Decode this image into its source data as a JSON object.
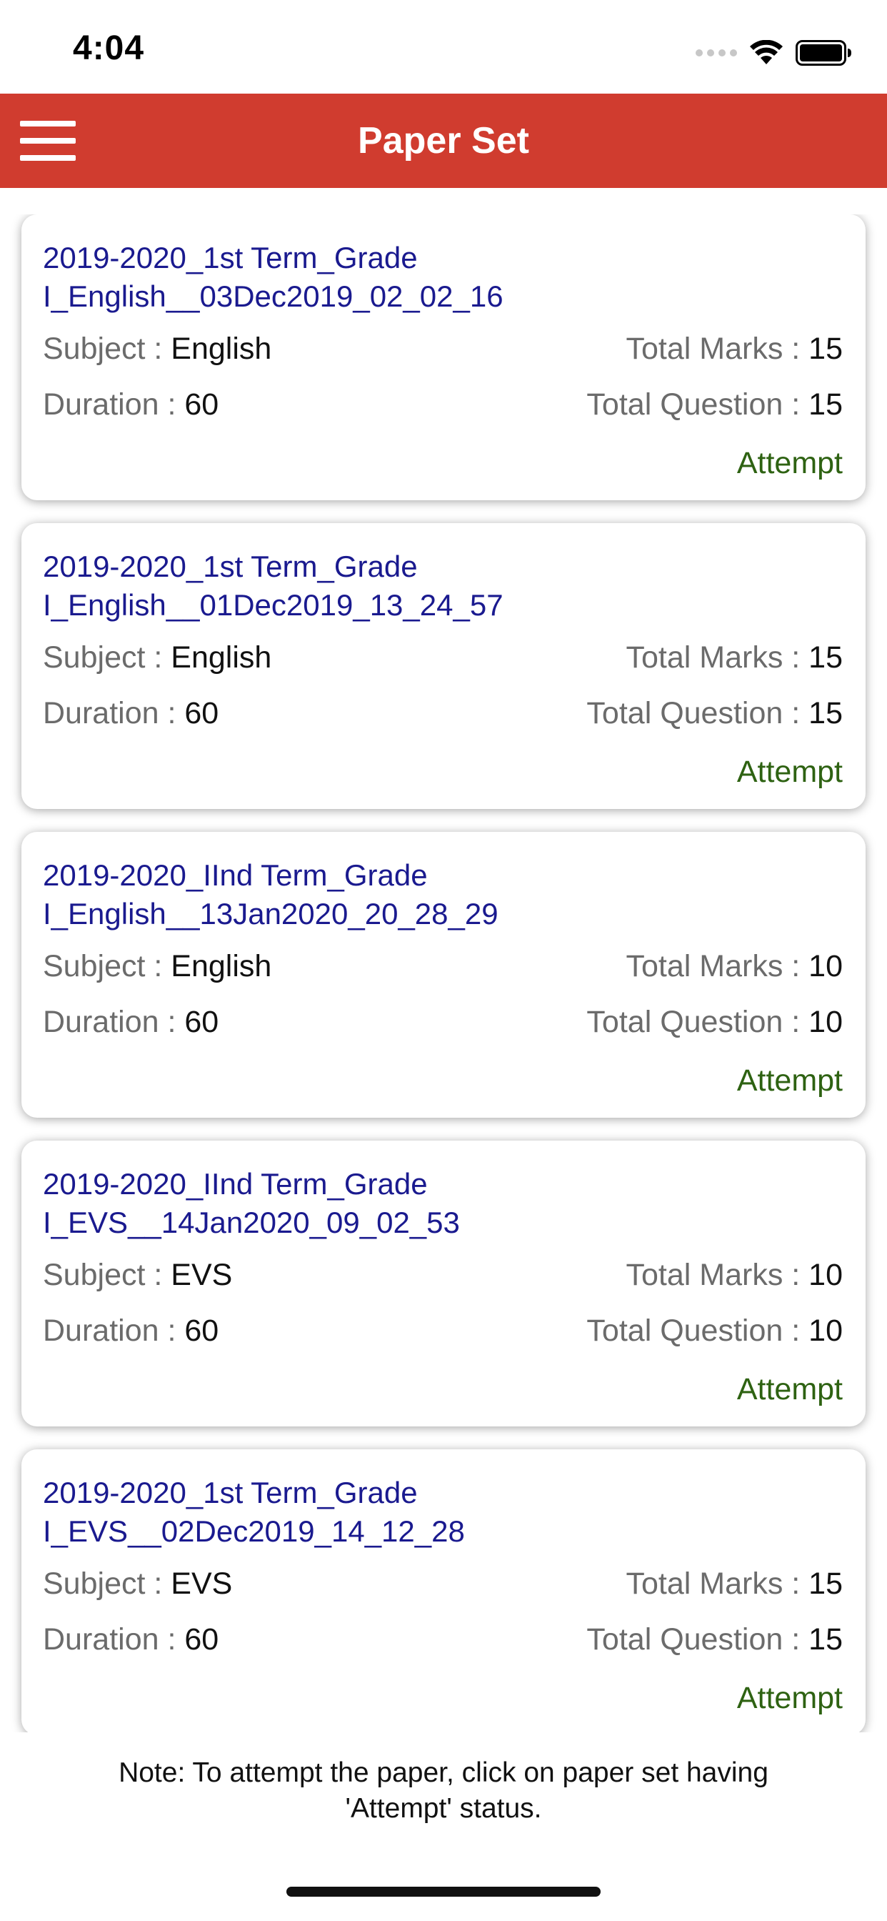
{
  "status_bar": {
    "time": "4:04",
    "icons": [
      "signal-icon",
      "wifi-icon",
      "battery-icon"
    ]
  },
  "header": {
    "title": "Paper Set",
    "menu_icon": "hamburger-menu-icon",
    "background_color": "#d03c2f"
  },
  "labels": {
    "subject": "Subject : ",
    "duration": "Duration : ",
    "total_marks": "Total Marks : ",
    "total_question": "Total Question : "
  },
  "papers": [
    {
      "title": "2019-2020_1st Term_Grade I_English__03Dec2019_02_02_16",
      "subject": "English",
      "duration": "60",
      "total_marks": "15",
      "total_question": "15",
      "status": "Attempt"
    },
    {
      "title": "2019-2020_1st Term_Grade I_English__01Dec2019_13_24_57",
      "subject": "English",
      "duration": "60",
      "total_marks": "15",
      "total_question": "15",
      "status": "Attempt"
    },
    {
      "title": "2019-2020_IInd Term_Grade I_English__13Jan2020_20_28_29",
      "subject": "English",
      "duration": "60",
      "total_marks": "10",
      "total_question": "10",
      "status": "Attempt"
    },
    {
      "title": "2019-2020_IInd Term_Grade I_EVS__14Jan2020_09_02_53",
      "subject": "EVS",
      "duration": "60",
      "total_marks": "10",
      "total_question": "10",
      "status": "Attempt"
    },
    {
      "title": "2019-2020_1st Term_Grade I_EVS__02Dec2019_14_12_28",
      "subject": "EVS",
      "duration": "60",
      "total_marks": "15",
      "total_question": "15",
      "status": "Attempt"
    }
  ],
  "footer": {
    "note": "Note: To attempt the paper, click on paper set having 'Attempt' status."
  },
  "colors": {
    "title_text": "#1a1a8f",
    "attempt_text": "#2e6212",
    "label_text": "#6b6b6b"
  }
}
